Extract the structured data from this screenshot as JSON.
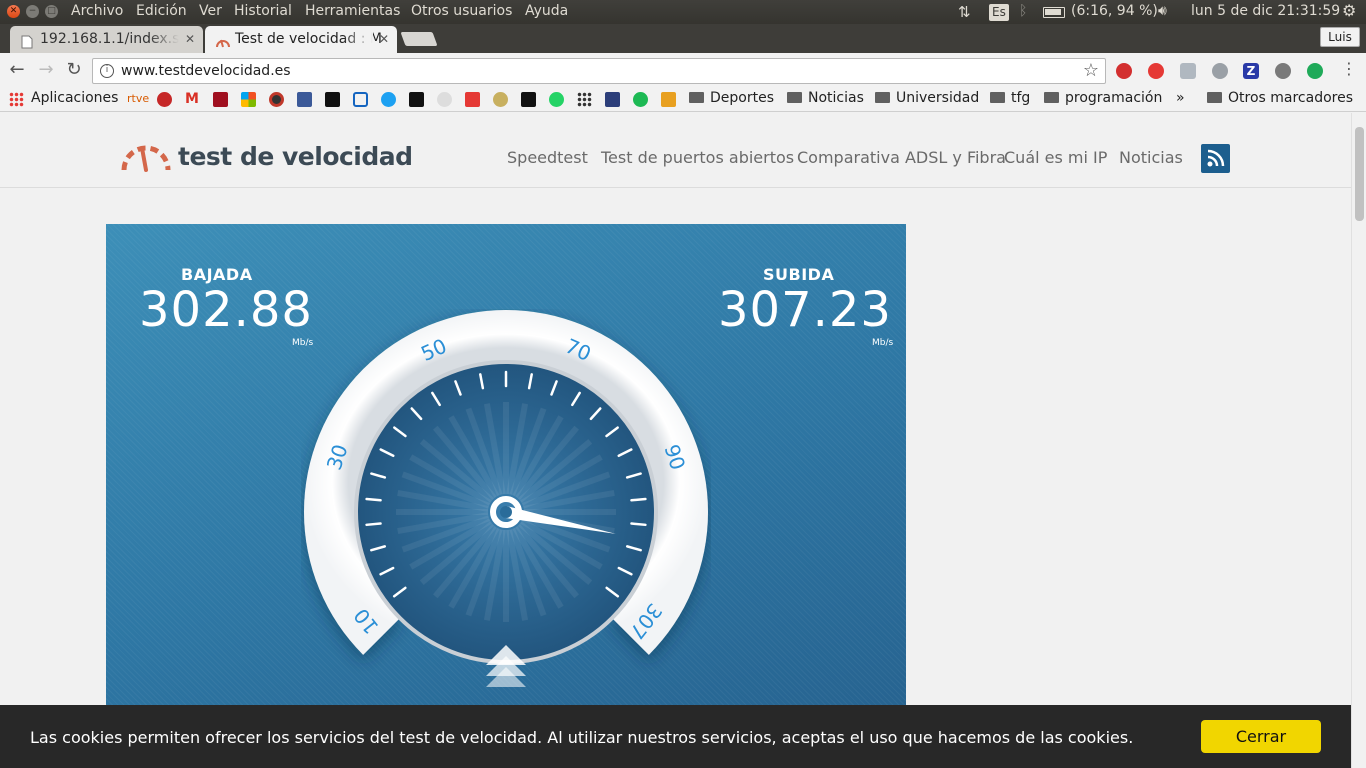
{
  "os": {
    "menus": [
      "Archivo",
      "Edición",
      "Ver",
      "Historial",
      "Herramientas",
      "Otros usuarios",
      "Ayuda"
    ],
    "keyboard": "Es",
    "battery": "(6:16, 94 %)",
    "clock": "lun  5 de dic 21:31:59"
  },
  "tabs": [
    {
      "title": "192.168.1.1/index.s",
      "active": false
    },
    {
      "title": "Test de velocidad : M",
      "active": true
    }
  ],
  "profile": "Luis",
  "address": {
    "url": "www.testdevelocidad.es"
  },
  "bookmarks": {
    "apps": "Aplicaciones",
    "rtve": "rtve",
    "folders": [
      "Deportes",
      "Noticias",
      "Universidad",
      "tfg",
      "programación"
    ],
    "more": "»",
    "other": "Otros marcadores"
  },
  "site": {
    "logo": "test de velocidad",
    "nav": [
      "Speedtest",
      "Test de puertos abiertos",
      "Comparativa ADSL y Fibra",
      "Cuál es mi IP",
      "Noticias"
    ]
  },
  "speedtest": {
    "download_label": "BAJADA",
    "download_value": "302.88",
    "upload_label": "SUBIDA",
    "upload_value": "307.23",
    "unit": "Mb/s",
    "dial_labels": [
      "10",
      "30",
      "50",
      "70",
      "90",
      "307"
    ],
    "needle_value": 307
  },
  "cookie": {
    "text": "Las cookies permiten ofrecer los servicios del test de velocidad. Al utilizar nuestros servicios, aceptas el uso que hacemos de las cookies.",
    "button": "Cerrar"
  },
  "colors": {
    "accent": "#1c5e8e",
    "cookie_button": "#f1d600",
    "dial_label": "#2b8fd6"
  }
}
